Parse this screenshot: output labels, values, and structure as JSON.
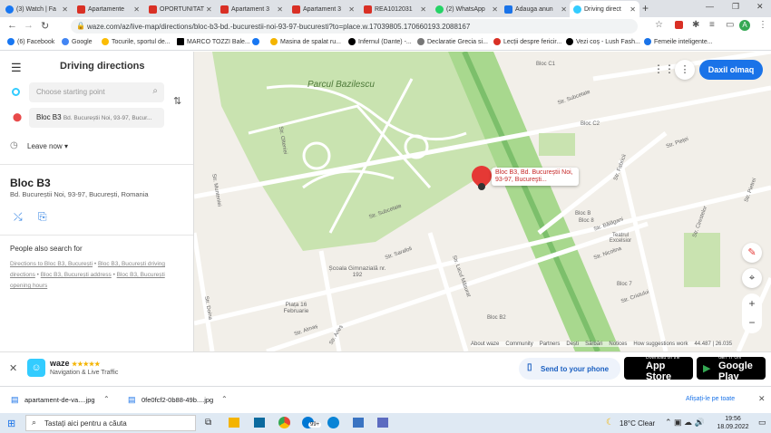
{
  "browser": {
    "tabs": [
      {
        "label": "(3) Watch | Fa",
        "color": "#1877f2"
      },
      {
        "label": "Apartamente",
        "color": "#d93025"
      },
      {
        "label": "OPORTUNITAT",
        "color": "#d93025"
      },
      {
        "label": "Apartament 3",
        "color": "#d93025"
      },
      {
        "label": "Apartament 3",
        "color": "#d93025"
      },
      {
        "label": "REA1012031",
        "color": "#d93025"
      },
      {
        "label": "(2) WhatsApp",
        "color": "#25d366"
      },
      {
        "label": "Adauga anun",
        "color": "#1a73e8"
      },
      {
        "label": "Driving direct",
        "color": "#33ccff",
        "active": true
      }
    ],
    "url": "waze.com/az/live-map/directions/bloc-b3-bd.-bucurestii-noi-93-97-bucuresti?to=place.w.17039805.170660193.2088167",
    "profile_initial": "A",
    "bookmarks": [
      "(6) Facebook",
      "Google",
      "Tocurile, sportul de...",
      "MARCO TOZZI Bale...",
      "",
      "Masina de spalat ru...",
      "Infernul (Dante) -...",
      "Declaratie Grecia si...",
      "Lecții despre fericir...",
      "Vezi coș - Lush Fash...",
      "Femeile inteligente..."
    ]
  },
  "panel": {
    "title": "Driving directions",
    "start_placeholder": "Choose starting point",
    "destination_name": "Bloc B3",
    "destination_address": "Bd. Bucureștii Noi, 93-97, Bucur...",
    "leave_label": "Leave now",
    "place_title": "Bloc B3",
    "place_address": "Bd. Bucureștii Noi, 93-97, București, Romania",
    "people_also": "People also search for",
    "suggestions": [
      "Directions to Bloc B3, București",
      "Bloc B3, București driving directions",
      "Bloc B3, București address",
      "Bloc B3, București opening hours"
    ]
  },
  "map": {
    "login_button": "Daxil olmaq",
    "park_label": "Parcul Bazilescu",
    "marker_label": "Bloc B3, Bd. Bucureștii Noi, 93-97, Bucureşti...",
    "streets": [
      "Str. Subcetate",
      "Str. Olteniei",
      "Str. Muntenieі",
      "Str. Subcetate",
      "Str. Sarafoli",
      "Str. Lacul Măsurat",
      "Str. Pieței",
      "Str. Bălăgani",
      "Str. Nicolina",
      "Str. Cristului",
      "Str. Pietrei",
      "Str. Fabricii",
      "Str. Cirestelor",
      "Str. Almaș",
      "Str. Doina",
      "Str. Arieș"
    ],
    "poi": [
      "Școala Gimnazială nr. 192",
      "Piața 16 Februarie",
      "Teatrul Excelsior",
      "Bloc C1",
      "Bloc C2",
      "Bloc B",
      "Bloc 8",
      "Bloc 7",
      "Bloc B2"
    ],
    "footer_links": [
      "About waze",
      "Community",
      "Partners",
      "Dești",
      "Sărbări",
      "Notices",
      "How suggestions work"
    ],
    "coords": "44.487 | 26.035"
  },
  "banner": {
    "brand": "waze",
    "stars": "★★★★★",
    "subtitle": "Navigation & Live Traffic",
    "send_phone": "Send to your phone",
    "appstore_small": "Download on the",
    "appstore": "App Store",
    "googleplay_small": "GET IT ON",
    "googleplay": "Google Play"
  },
  "downloads": {
    "files": [
      "apartament-de-va....jpg",
      "0fe0fcf2-0b88-49b....jpg"
    ],
    "show_all": "Afișați-le pe toate"
  },
  "taskbar": {
    "search": "Tastați aici pentru a căuta",
    "weather": "18°C  Clear",
    "time": "19:56",
    "date": "18.09.2022",
    "badge": "99+"
  }
}
